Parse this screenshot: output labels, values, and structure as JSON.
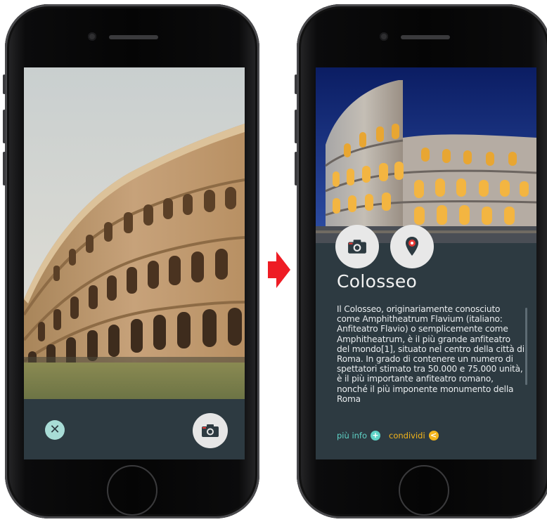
{
  "left_screen": {
    "close_icon_glyph": "✕"
  },
  "right_screen": {
    "title": "Colosseo",
    "description": "Il Colosseo, originariamente conosciuto come Amphitheatrum Flavium (italiano: Anfiteatro Flavio) o semplicemente come Amphitheatrum, è il più grande anfiteatro del mondo[1], situato nel centro della città di Roma. In grado di contenere un numero di spettatori stimato tra 50.000 e 75.000 unità, è il più importante anfiteatro romano, nonché il più imponente monumento della Roma",
    "more_info_label": "più info",
    "more_info_icon_glyph": "+",
    "share_label": "condividi",
    "share_icon_glyph": "<"
  },
  "colors": {
    "panel": "#2d3a41",
    "accent_teal": "#5fd3c7",
    "accent_orange": "#f4b51b",
    "arrow_red": "#ee1c24",
    "pin_red": "#e53935"
  }
}
